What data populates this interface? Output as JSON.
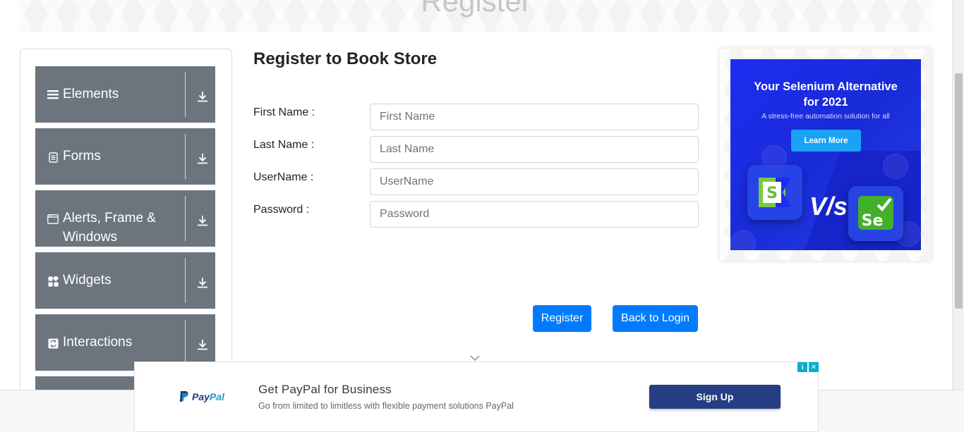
{
  "banner": {
    "title": "Register"
  },
  "sidebar": {
    "groups": [
      {
        "label": "Elements",
        "icon": "hamburger-icon"
      },
      {
        "label": "Forms",
        "icon": "document-icon"
      },
      {
        "label": "Alerts, Frame & Windows",
        "icon": "window-icon"
      },
      {
        "label": "Widgets",
        "icon": "widgets-icon"
      },
      {
        "label": "Interactions",
        "icon": "interactions-icon"
      }
    ],
    "arrow_icon": "download-arrow-icon"
  },
  "form": {
    "heading": "Register to Book Store",
    "fields": [
      {
        "label": "First Name :",
        "placeholder": "First Name"
      },
      {
        "label": "Last Name :",
        "placeholder": "Last Name"
      },
      {
        "label": "UserName :",
        "placeholder": "UserName"
      },
      {
        "label": "Password :",
        "placeholder": "Password"
      }
    ],
    "register_label": "Register",
    "back_label": "Back to Login"
  },
  "side_ad": {
    "title_line1": "Your Selenium Alternative",
    "title_line2": "for 2021",
    "subtitle": "A stress-free automation solution for all",
    "button": "Learn More",
    "vs": "V/s",
    "tile_left": "S",
    "tile_right": "Se"
  },
  "bottom_ad": {
    "brand_left": "Pay",
    "brand_right": "Pal",
    "title": "Get PayPal for Business",
    "description": "Go from limited to limitless with flexible payment solutions PayPal",
    "button": "Sign Up",
    "info": "i",
    "close": "✕"
  },
  "colors": {
    "sidebar_group": "#6c757d",
    "primary_button": "#007bff",
    "paypal_button": "#253d83",
    "ad_blue": "#1e2cf0"
  }
}
